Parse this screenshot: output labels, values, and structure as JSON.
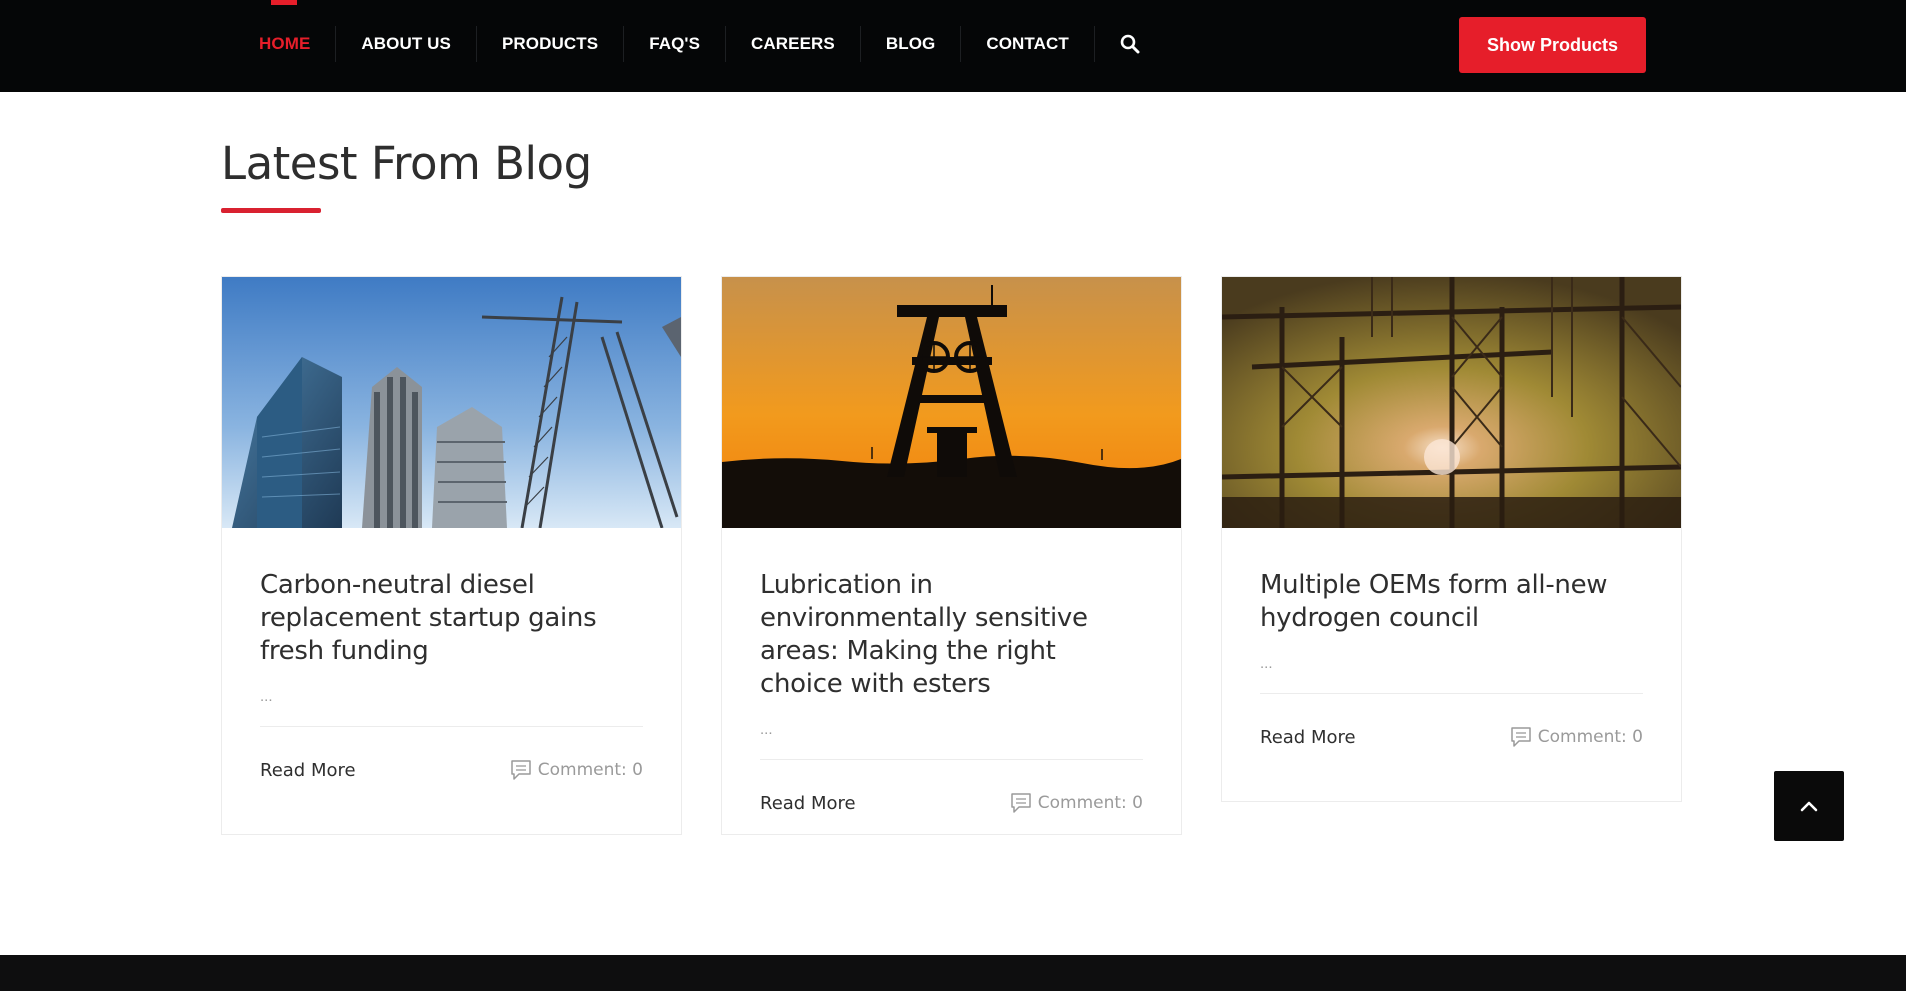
{
  "nav": {
    "items": [
      {
        "label": "HOME",
        "active": true
      },
      {
        "label": "ABOUT US",
        "active": false
      },
      {
        "label": "PRODUCTS",
        "active": false
      },
      {
        "label": "FAQ'S",
        "active": false
      },
      {
        "label": "CAREERS",
        "active": false
      },
      {
        "label": "BLOG",
        "active": false
      },
      {
        "label": "CONTACT",
        "active": false
      }
    ],
    "search_icon": "search-icon",
    "cta_label": "Show Products"
  },
  "section": {
    "title": "Latest From Blog"
  },
  "posts": [
    {
      "title": "Carbon-neutral diesel replacement startup gains fresh funding",
      "excerpt": "...",
      "read_more": "Read More",
      "comments": "Comment: 0",
      "image": "construction-cranes-photo"
    },
    {
      "title": "Lubrication in environmentally sensitive areas: Making the right choice with esters",
      "excerpt": "...",
      "read_more": "Read More",
      "comments": "Comment: 0",
      "image": "mine-headframe-sunset-photo"
    },
    {
      "title": "Multiple OEMs form all-new hydrogen council",
      "excerpt": "...",
      "read_more": "Read More",
      "comments": "Comment: 0",
      "image": "steel-structure-sunlight-photo"
    }
  ],
  "colors": {
    "accent": "#e61e2a",
    "topbar": "#050607",
    "text": "#2f2f2f",
    "muted": "#9a9a9a"
  },
  "back_to_top_icon": "chevron-up-icon"
}
